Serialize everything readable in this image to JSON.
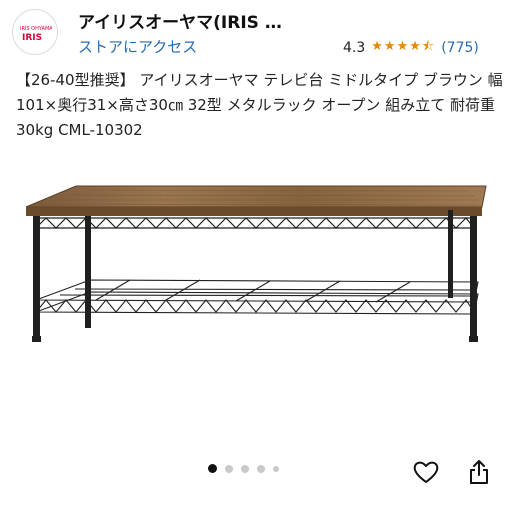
{
  "store": {
    "name": "アイリスオーヤマ(IRIS …",
    "link_label": "ストアにアクセス",
    "rating": "4.3",
    "review_count": "(775)",
    "star_color": "#e68a00"
  },
  "product": {
    "title": "【26-40型推奨】 アイリスオーヤマ テレビ台 ミドルタイプ ブラウン 幅101×奥行31×高さ30㎝ 32型 メタルラック オープン 組み立て 耐荷重30kg CML-10302"
  },
  "gallery": {
    "total_images": 5,
    "active_index": 0
  },
  "actions": {
    "favorite_icon": "heart-icon",
    "share_icon": "share-icon"
  }
}
